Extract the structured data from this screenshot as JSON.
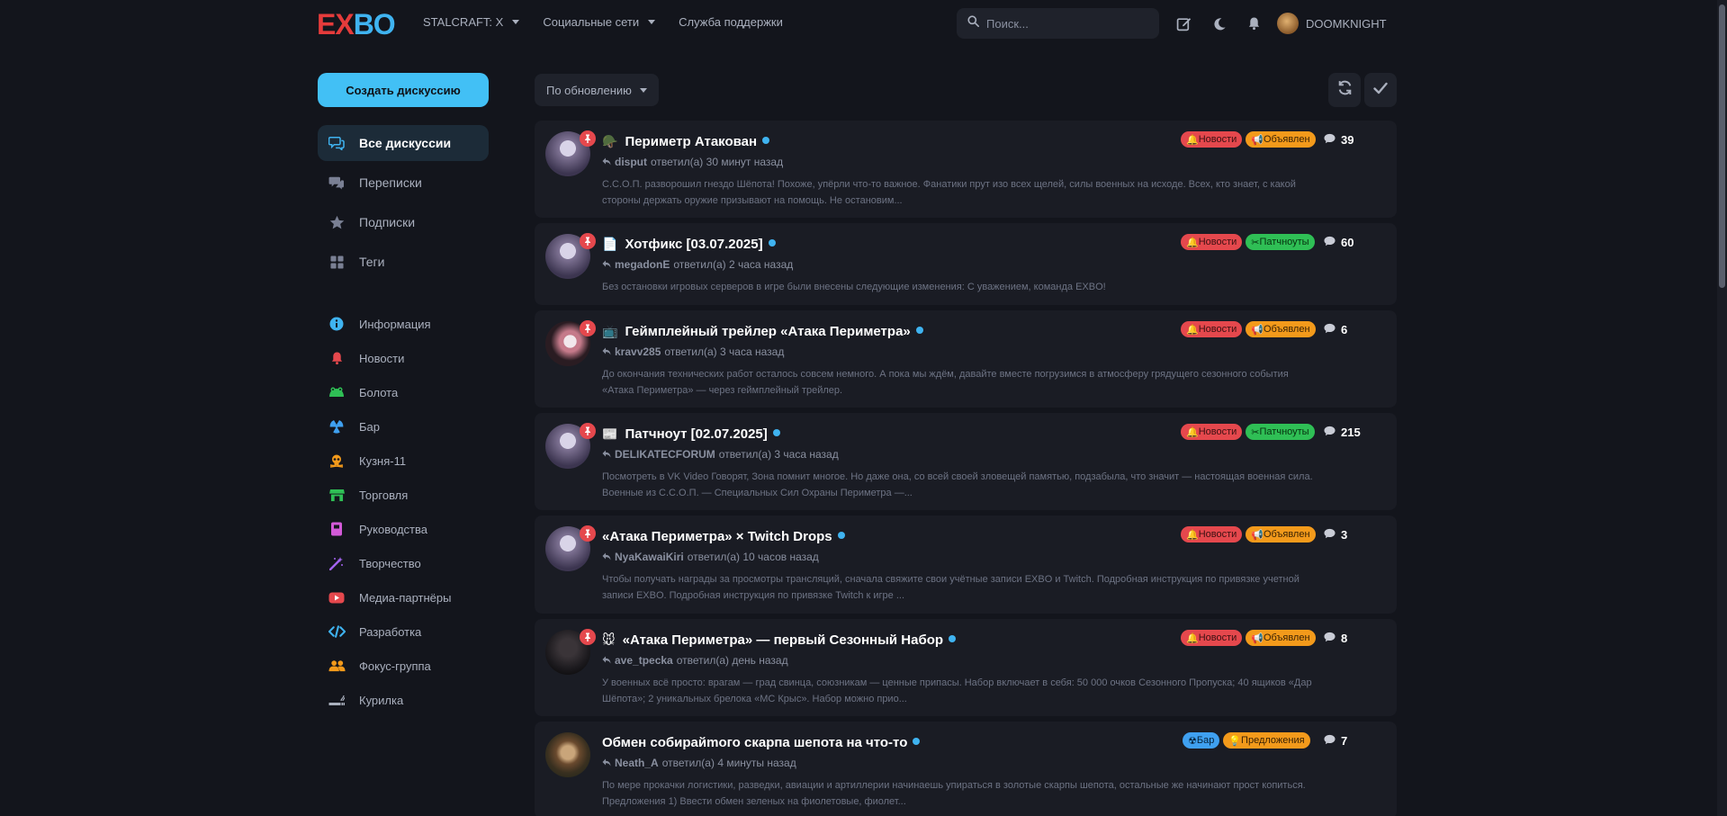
{
  "header": {
    "logo_left": "EX",
    "logo_right": "BO",
    "nav": [
      {
        "label": "STALCRAFT: X",
        "dropdown": true
      },
      {
        "label": "Социальные сети",
        "dropdown": true
      },
      {
        "label": "Служба поддержки",
        "dropdown": false
      }
    ],
    "search_placeholder": "Поиск...",
    "username": "DOOMKNIGHT"
  },
  "sidebar": {
    "create_label": "Создать дискуссию",
    "items": [
      {
        "label": "Все дискуссии",
        "icon": "discussions-icon",
        "active": true
      },
      {
        "label": "Переписки",
        "icon": "messages-icon",
        "active": false
      },
      {
        "label": "Подписки",
        "icon": "star-icon",
        "active": false
      },
      {
        "label": "Теги",
        "icon": "tags-grid-icon",
        "active": false
      }
    ],
    "tags": [
      {
        "label": "Информация",
        "icon": "info-icon",
        "color": "#3fb3f0"
      },
      {
        "label": "Новости",
        "icon": "bell-icon",
        "color": "#e5484d"
      },
      {
        "label": "Болота",
        "icon": "frog-icon",
        "color": "#2fbf55"
      },
      {
        "label": "Бар",
        "icon": "radiation-icon",
        "color": "#3fa0f0"
      },
      {
        "label": "Кузня-11",
        "icon": "skull-icon",
        "color": "#f39a1b"
      },
      {
        "label": "Торговля",
        "icon": "store-icon",
        "color": "#2fbf55"
      },
      {
        "label": "Руководства",
        "icon": "book-icon",
        "color": "#d35ad8"
      },
      {
        "label": "Творчество",
        "icon": "magic-icon",
        "color": "#a364f0"
      },
      {
        "label": "Медиа-партнёры",
        "icon": "youtube-icon",
        "color": "#e5484d"
      },
      {
        "label": "Разработка",
        "icon": "code-icon",
        "color": "#3fb3f0"
      },
      {
        "label": "Фокус-группа",
        "icon": "users-icon",
        "color": "#f39a1b"
      },
      {
        "label": "Курилка",
        "icon": "smoking-icon",
        "color": "#aab0be"
      }
    ]
  },
  "toolbar": {
    "sort_label": "По обновлению"
  },
  "discussions": [
    {
      "title": "Периметр Атакован",
      "emoji": "🪖",
      "pinned": true,
      "user": "disput",
      "action": "ответил(а)",
      "time": "30 минут назад",
      "excerpt": "С.С.О.П. разворошил гнездо Шёпота! Похоже, упёрли что-то важное. Фанатики прут изо всех щелей, силы военных на исходе. Всех, кто знает, с какой стороны держать оружие призывают на помощь. Не остановим...",
      "tags": [
        {
          "label": "Новости",
          "kind": "news"
        },
        {
          "label": "Объявлен",
          "kind": "ann"
        }
      ],
      "replies": "39"
    },
    {
      "title": "Хотфикс [03.07.2025]",
      "emoji": "📄",
      "pinned": true,
      "user": "megadonE",
      "action": "ответил(а)",
      "time": "2 часа назад",
      "excerpt": "Без остановки игровых серверов в игре были внесены следующие изменения: С уважением, команда EXBO!",
      "tags": [
        {
          "label": "Новости",
          "kind": "news"
        },
        {
          "label": "Патчноуты",
          "kind": "patch"
        }
      ],
      "replies": "60"
    },
    {
      "title": "Геймплейный трейлер «Атака Периметра»",
      "emoji": "📺",
      "pinned": true,
      "user": "kravv285",
      "action": "ответил(а)",
      "time": "3 часа назад",
      "excerpt": "До окончания технических работ осталось совсем немного. А пока мы ждём, давайте вместе погрузимся в атмосферу грядущего сезонного события «Атака Периметра» — через геймплейный трейлер.",
      "tags": [
        {
          "label": "Новости",
          "kind": "news"
        },
        {
          "label": "Объявлен",
          "kind": "ann"
        }
      ],
      "replies": "6"
    },
    {
      "title": "Патчноут [02.07.2025]",
      "emoji": "📰",
      "pinned": true,
      "user": "DELIKATECFORUM",
      "action": "ответил(а)",
      "time": "3 часа назад",
      "excerpt": "Посмотреть в VK Video Говорят, Зона помнит многое. Но даже она, со всей своей зловещей памятью, подзабыла, что значит — настоящая военная сила. Военные из С.С.О.П. — Специальных Сил Охраны Периметра —...",
      "tags": [
        {
          "label": "Новости",
          "kind": "news"
        },
        {
          "label": "Патчноуты",
          "kind": "patch"
        }
      ],
      "replies": "215"
    },
    {
      "title": "«Атака Периметра» × Twitch Drops",
      "emoji": "",
      "pinned": true,
      "user": "NyaKawaiKiri",
      "action": "ответил(а)",
      "time": "10 часов назад",
      "excerpt": "Чтобы получать награды за просмотры трансляций, сначала свяжите свои учётные записи EXBO и Twitch. Подробная инструкция по привязке учетной записи EXBO. Подробная инструкция по привязке Twitch к игре ...",
      "tags": [
        {
          "label": "Новости",
          "kind": "news"
        },
        {
          "label": "Объявлен",
          "kind": "ann"
        }
      ],
      "replies": "3"
    },
    {
      "title": "«Атака Периметра» — первый Сезонный Набор",
      "emoji": "🐭",
      "pinned": true,
      "user": "ave_tpecka",
      "action": "ответил(а)",
      "time": "день назад",
      "excerpt": "У военных всё просто: врагам — град свинца, союзникам — ценные припасы. Набор включает в себя: 50 000 очков Сезонного Пропуска; 40 ящиков «Дар Шёпота»; 2 уникальных брелока «МС Крыс». Набор можно прио...",
      "tags": [
        {
          "label": "Новости",
          "kind": "news"
        },
        {
          "label": "Объявлен",
          "kind": "ann"
        }
      ],
      "replies": "8"
    },
    {
      "title": "Обмен собирайmого скарпа шепота на что-то",
      "emoji": "",
      "pinned": false,
      "user": "Neath_A",
      "action": "ответил(а)",
      "time": "4 минуты назад",
      "excerpt": "По мере прокачки логистики, разведки, авиации и артиллерии начинаешь упираться в золотые скарпы шепота, остальные же начинают прост копиться. Предложения 1) Ввести обмен зеленых на фиолетовые, фиолет...",
      "tags": [
        {
          "label": "Бар",
          "kind": "bar"
        },
        {
          "label": "Предложения",
          "kind": "prop"
        }
      ],
      "replies": "7"
    }
  ]
}
